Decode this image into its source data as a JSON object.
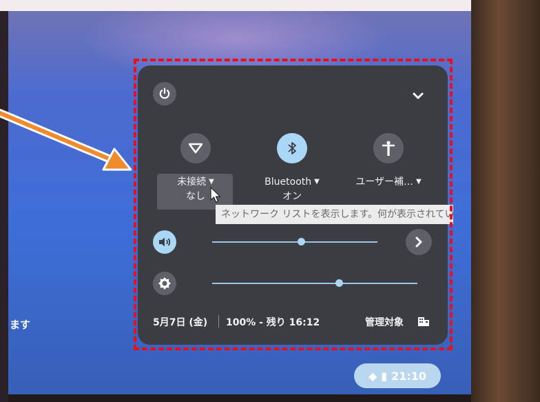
{
  "background": {
    "left_text": "ます"
  },
  "panel": {
    "features": {
      "network": {
        "label": "未接続",
        "sub": "なし",
        "state": "off",
        "icon": "wifi-off-icon"
      },
      "bluetooth": {
        "label": "Bluetooth",
        "sub": "オン",
        "state": "on",
        "icon": "bluetooth-icon"
      },
      "accessibility": {
        "label": "ユーザー補…",
        "sub": "",
        "state": "off",
        "icon": "accessibility-icon"
      }
    },
    "tooltip": "ネットワーク リストを表示します。何が表示されている",
    "sliders": {
      "volume": {
        "icon": "volume-icon",
        "level": 0.54
      },
      "brightness": {
        "icon": "brightness-icon",
        "level": 0.62
      }
    },
    "footer": {
      "date": "5月7日 (金)",
      "battery": "100% - 残り 16:12",
      "managed": "管理対象"
    }
  },
  "shelf": {
    "time": "21:10"
  },
  "colors": {
    "annotation": "#e8101a",
    "panel_bg": "#3b3d42",
    "accent": "#a9d7f5"
  }
}
